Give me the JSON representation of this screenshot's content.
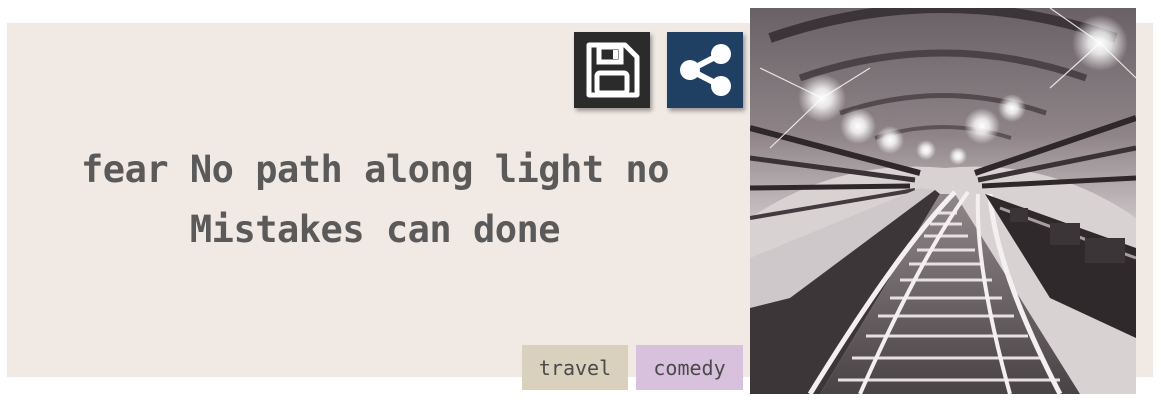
{
  "quote": {
    "line1": "fear No path along light no",
    "line2": "Mistakes can done"
  },
  "actions": {
    "save_icon": "floppy-disk-icon",
    "share_icon": "share-icon",
    "save_color": "#2b2b2b",
    "share_color": "#1f3f63"
  },
  "tags": [
    {
      "label": "travel",
      "color": "#d9d1bd"
    },
    {
      "label": "comedy",
      "color": "#d8c1dc"
    }
  ],
  "image": {
    "subject": "subway tunnel with railway tracks and lights"
  }
}
